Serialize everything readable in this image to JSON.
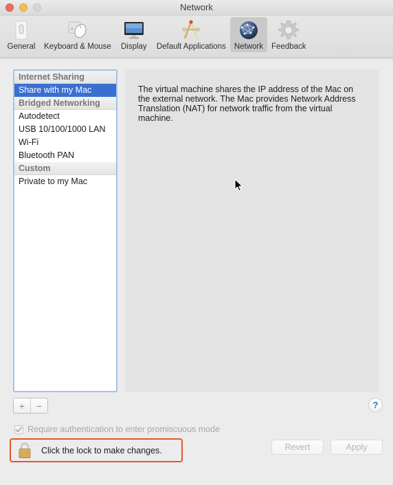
{
  "window": {
    "title": "Network",
    "traffic_lights": [
      {
        "name": "close",
        "color": "#eb6e64"
      },
      {
        "name": "minimize",
        "color": "#f2be4d"
      },
      {
        "name": "zoom",
        "color": "#d6d6d6"
      }
    ]
  },
  "toolbar": {
    "items": [
      {
        "id": "general",
        "label": "General",
        "icon": "switch-icon",
        "selected": false
      },
      {
        "id": "keyboard-mouse",
        "label": "Keyboard & Mouse",
        "icon": "mouse-icon",
        "selected": false
      },
      {
        "id": "display",
        "label": "Display",
        "icon": "display-icon",
        "selected": false
      },
      {
        "id": "default-applications",
        "label": "Default Applications",
        "icon": "compass-ruler-icon",
        "selected": false
      },
      {
        "id": "network",
        "label": "Network",
        "icon": "globe-network-icon",
        "selected": true
      },
      {
        "id": "feedback",
        "label": "Feedback",
        "icon": "gear-icon",
        "selected": false
      }
    ]
  },
  "sidebar": {
    "rows": [
      {
        "label": "Internet Sharing",
        "type": "group",
        "selected": false
      },
      {
        "label": "Share with my Mac",
        "type": "item",
        "selected": true
      },
      {
        "label": "Bridged Networking",
        "type": "group",
        "selected": false
      },
      {
        "label": "Autodetect",
        "type": "item",
        "selected": false
      },
      {
        "label": "USB 10/100/1000 LAN",
        "type": "item",
        "selected": false
      },
      {
        "label": "Wi-Fi",
        "type": "item",
        "selected": false
      },
      {
        "label": "Bluetooth PAN",
        "type": "item",
        "selected": false
      },
      {
        "label": "Custom",
        "type": "group",
        "selected": false
      },
      {
        "label": "Private to my Mac",
        "type": "item",
        "selected": false
      }
    ],
    "add_label": "+",
    "remove_label": "−",
    "focus_ring_color": "#a4c2e8",
    "selection_color": "#3a6fd1"
  },
  "detail": {
    "description": "The virtual machine shares the IP address of the Mac on the external network. The Mac provides Network Address Translation (NAT) for network traffic from the virtual machine."
  },
  "help": {
    "label": "?"
  },
  "promiscuous": {
    "label": "Require authentication to enter promiscuous mode",
    "checked": true,
    "enabled": false
  },
  "lock": {
    "label": "Click the lock to make changes.",
    "state": "locked",
    "highlight_color": "#e8542a"
  },
  "buttons": {
    "revert": "Revert",
    "apply": "Apply",
    "enabled": false
  }
}
